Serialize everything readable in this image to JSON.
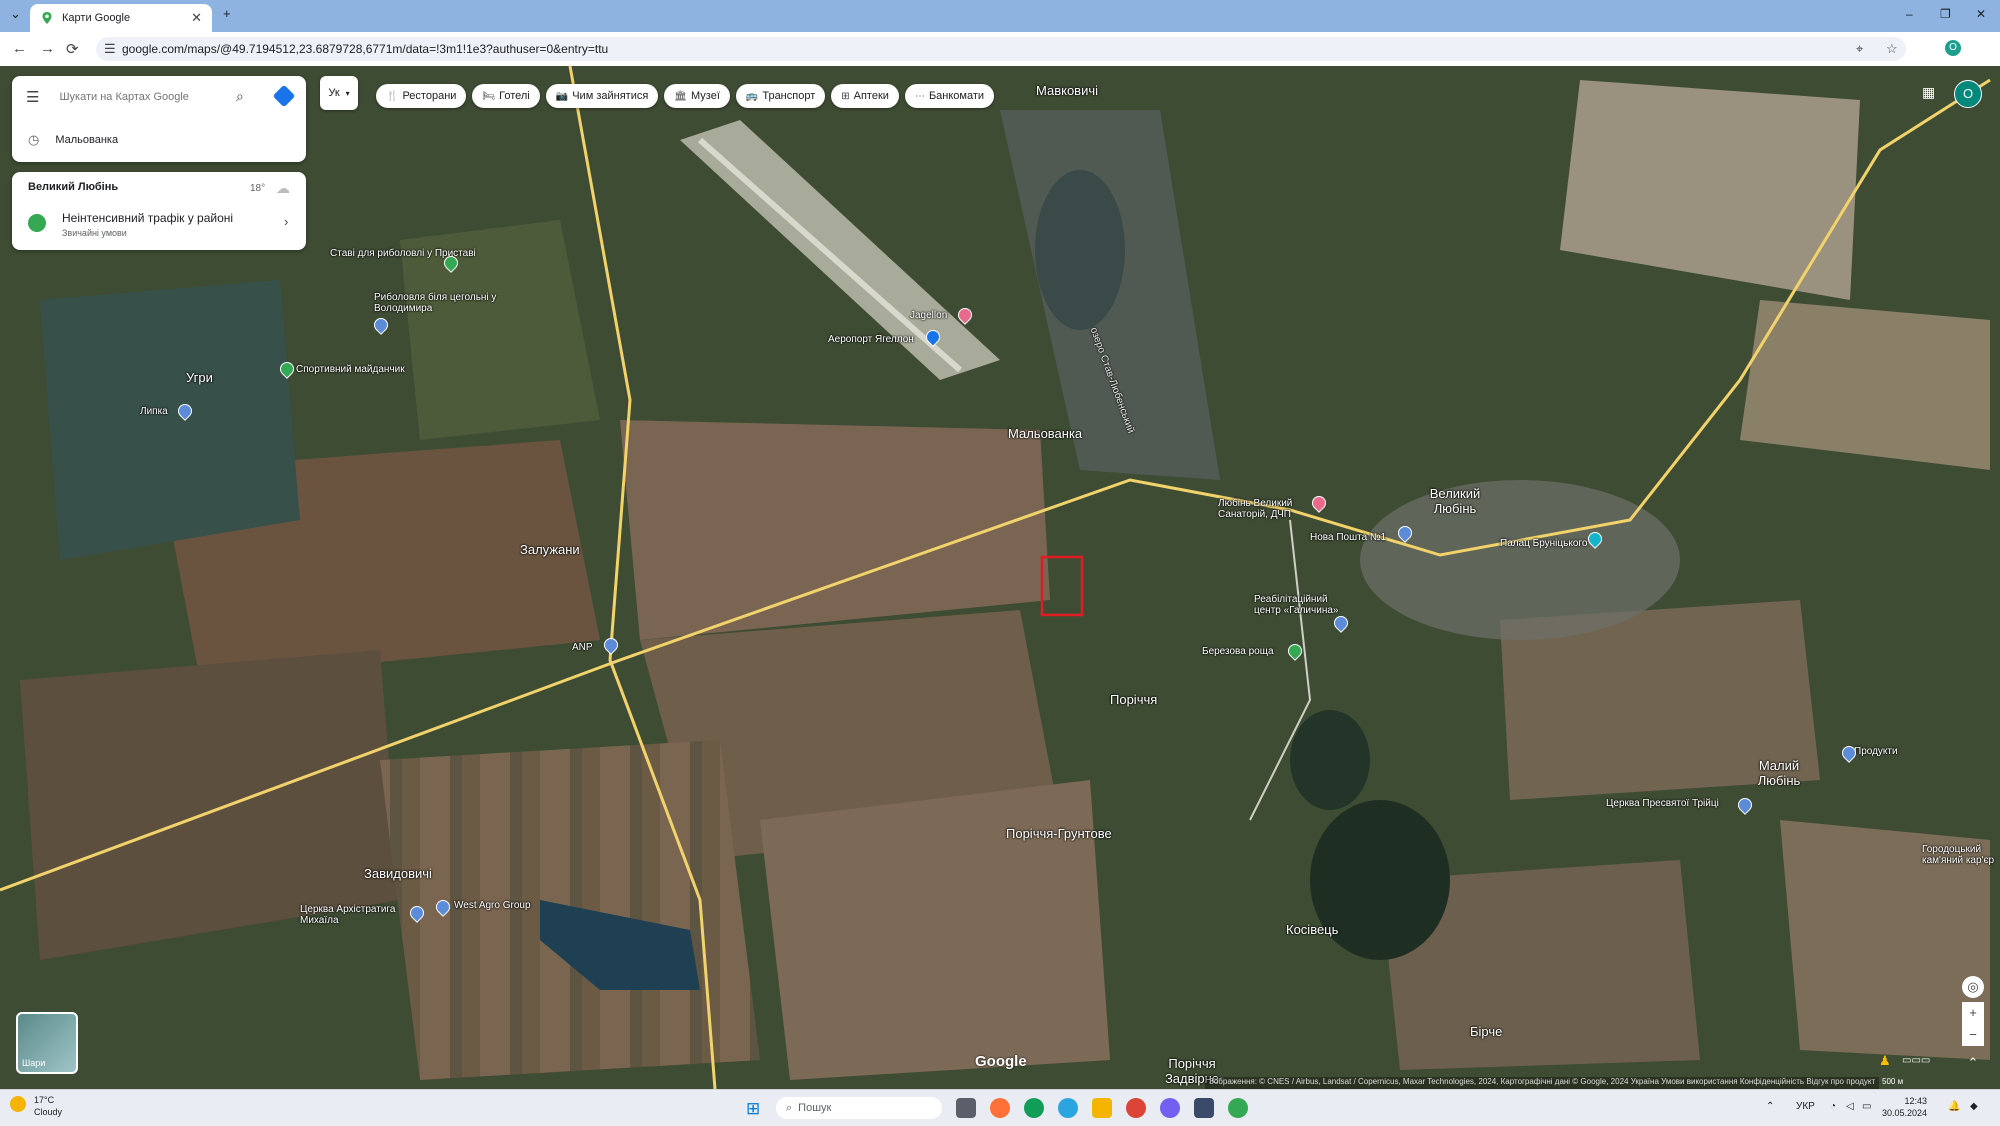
{
  "browser": {
    "tab_title": "Карти Google",
    "tab_close": "✕",
    "new_tab": "+",
    "tab_menu": "⌄",
    "url": "google.com/maps/@49.7194512,23.6879728,6771m/data=!3m1!1e3?authuser=0&entry=ttu",
    "nav": {
      "back": "←",
      "forward": "→",
      "reload": "⟳"
    },
    "window": {
      "minimize": "–",
      "maximize": "❐",
      "close": "✕"
    },
    "profile_initial": "O"
  },
  "maps": {
    "search_placeholder": "Шукати на Картах Google",
    "recent_search": "Мальованка",
    "language_selector": "Ук",
    "chips": [
      {
        "icon": "fork-knife-icon",
        "glyph": "🍴",
        "label": "Ресторани"
      },
      {
        "icon": "bed-icon",
        "glyph": "🛏",
        "label": "Готелі"
      },
      {
        "icon": "camera-icon",
        "glyph": "📷",
        "label": "Чим зайнятися"
      },
      {
        "icon": "museum-icon",
        "glyph": "🏛",
        "label": "Музеї"
      },
      {
        "icon": "bus-icon",
        "glyph": "🚌",
        "label": "Транспорт"
      },
      {
        "icon": "pharmacy-icon",
        "glyph": "⊞",
        "label": "Аптеки"
      },
      {
        "icon": "atm-icon",
        "glyph": "⋯",
        "label": "Банкомати"
      }
    ],
    "info_card": {
      "place": "Великий Любінь",
      "temperature": "18°",
      "traffic": "Неінтенсивний трафік у районі",
      "traffic_sub": "Звичайні умови"
    },
    "avatar_initial": "O",
    "layers_label": "Шари",
    "google_logo": "Google",
    "attribution": "Зображення: © CNES / Airbus, Landsat / Copernicus, Maxar Technologies, 2024, Картографічні дані © Google, 2024    Україна    Умови використання    Конфіденційність    Відгук про продукт",
    "scale": "500 м",
    "labels": [
      {
        "text": "Мавковичі",
        "cls": "big"
      },
      {
        "text": "Ставі для риболовлі у Приставі",
        "cls": ""
      },
      {
        "text": "Риболовля біля цегольні у Володимира",
        "cls": ""
      },
      {
        "text": "Спортивний майданчик",
        "cls": ""
      },
      {
        "text": "Угри",
        "cls": "big"
      },
      {
        "text": "Липка",
        "cls": ""
      },
      {
        "text": "Jagellon",
        "cls": ""
      },
      {
        "text": "Аеропорт Ягеллон",
        "cls": ""
      },
      {
        "text": "Мальованка",
        "cls": "big"
      },
      {
        "text": "Залужани",
        "cls": "big"
      },
      {
        "text": "ANP",
        "cls": ""
      },
      {
        "text": "Любінь Великий Санаторій, ДЧП",
        "cls": ""
      },
      {
        "text": "Нова Пошта №1",
        "cls": ""
      },
      {
        "text": "Великий Любінь",
        "cls": "big"
      },
      {
        "text": "Палац Бруніцького",
        "cls": ""
      },
      {
        "text": "Реабілітаційний центр «Галичина»",
        "cls": ""
      },
      {
        "text": "Березова роща",
        "cls": ""
      },
      {
        "text": "Поріччя",
        "cls": "big"
      },
      {
        "text": "Поріччя-Грунтове",
        "cls": "big"
      },
      {
        "text": "Завидовичі",
        "cls": "big"
      },
      {
        "text": "Церква Архістратига Михаїла",
        "cls": ""
      },
      {
        "text": "West Agro Group",
        "cls": ""
      },
      {
        "text": "Косівець",
        "cls": "big"
      },
      {
        "text": "Малий Любінь",
        "cls": "big"
      },
      {
        "text": "Продукти",
        "cls": ""
      },
      {
        "text": "Церква Пресвятої Трійці",
        "cls": ""
      },
      {
        "text": "Городоцький кам'яний кар'єр",
        "cls": ""
      },
      {
        "text": "Бірче",
        "cls": "big"
      },
      {
        "text": "Поріччя Задвірне",
        "cls": "big"
      },
      {
        "text": "озеро Став-Любенський",
        "cls": "road"
      }
    ],
    "colors": {
      "road": "#f2d36b",
      "selection": "#e01b24",
      "water": "#1f3f52"
    }
  },
  "taskbar": {
    "weather_temp": "17°C",
    "weather_desc": "Cloudy",
    "search_placeholder": "Пошук",
    "language": "УКР",
    "time": "12:43",
    "date": "30.05.2024"
  }
}
